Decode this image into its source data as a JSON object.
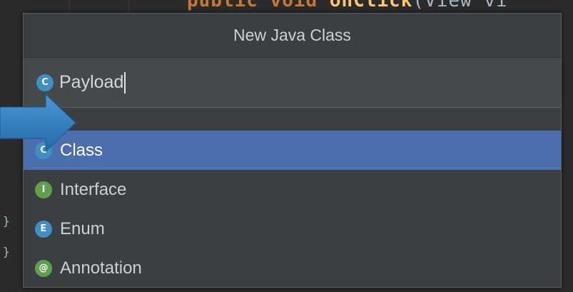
{
  "background": {
    "code_keyword": "public void ",
    "code_function": "onClick",
    "code_rest": "(View vi",
    "edge_mark": "}"
  },
  "dialog": {
    "title": "New Java Class",
    "name_field": {
      "value": "Payload",
      "icon": "class-icon",
      "icon_letter": "C"
    },
    "kinds": [
      {
        "label": "Class",
        "icon": "class-icon",
        "letter": "C",
        "color": "#3d8fc4",
        "selected": true
      },
      {
        "label": "Interface",
        "icon": "interface-icon",
        "letter": "I",
        "color": "#5fa14a",
        "selected": false
      },
      {
        "label": "Enum",
        "icon": "enum-icon",
        "letter": "E",
        "color": "#3d8fc4",
        "selected": false
      },
      {
        "label": "Annotation",
        "icon": "annotation-icon",
        "letter": "@",
        "color": "#5fa14a",
        "selected": false
      }
    ]
  },
  "colors": {
    "selection": "#4b6eaf",
    "dialog_bg": "#3c3f41",
    "arrow": "#2f7fc2"
  }
}
